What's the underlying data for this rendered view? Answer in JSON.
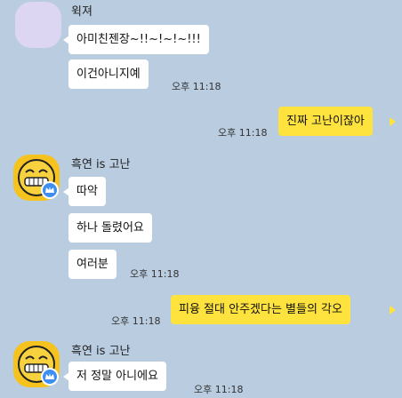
{
  "messages": {
    "m1": {
      "sender": "윅져",
      "bubbles": [
        "아미친젠장~!!~!~!~!!!",
        "이건아니지예"
      ],
      "time": "오후 11:18"
    },
    "m2": {
      "bubble": "진짜 고난이잖아",
      "time": "오후 11:18"
    },
    "m3": {
      "sender": "흑연 is 고난",
      "bubbles": [
        "따악",
        "하나 돌렸어요",
        "여러분"
      ],
      "time": "오후 11:18"
    },
    "m4": {
      "bubble": "피융 절대 안주겠다는 별들의 각오",
      "time": "오후 11:18"
    },
    "m5": {
      "sender": "흑연 is 고난",
      "bubbles": [
        "저 정말 아니에요"
      ],
      "time": "오후 11:18"
    }
  },
  "colors": {
    "background": "#b9cce0",
    "my_bubble": "#fee33e",
    "other_bubble": "#ffffff"
  }
}
